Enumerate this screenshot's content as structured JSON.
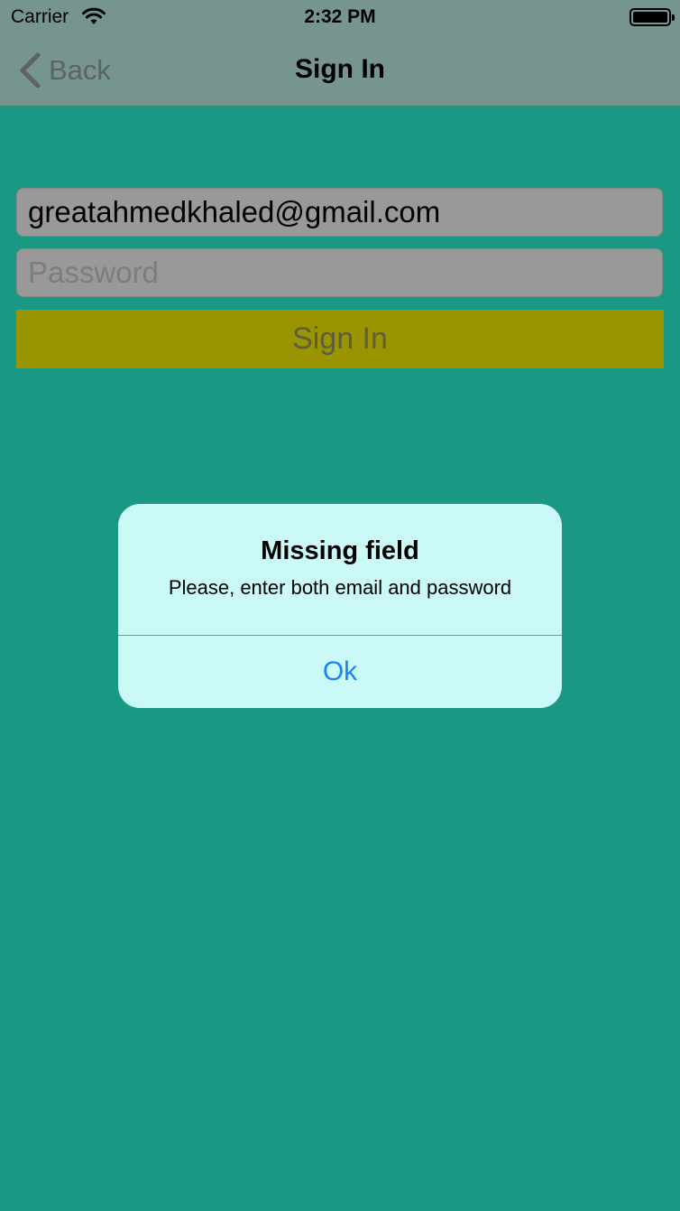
{
  "status_bar": {
    "carrier": "Carrier",
    "time": "2:32 PM",
    "wifi_icon": "wifi-icon",
    "battery_icon": "battery-icon"
  },
  "nav": {
    "back_label": "Back",
    "back_icon": "chevron-left-icon",
    "title": "Sign In"
  },
  "form": {
    "email_value": "greatahmedkhaled@gmail.com",
    "password_placeholder": "Password",
    "submit_label": "Sign In"
  },
  "alert": {
    "title": "Missing field",
    "message": "Please, enter both email and password",
    "ok_label": "Ok"
  },
  "colors": {
    "background": "#1a9883",
    "alert_background": "#cbf9f8",
    "button_background": "#999400",
    "link_blue": "#1a82ff"
  }
}
